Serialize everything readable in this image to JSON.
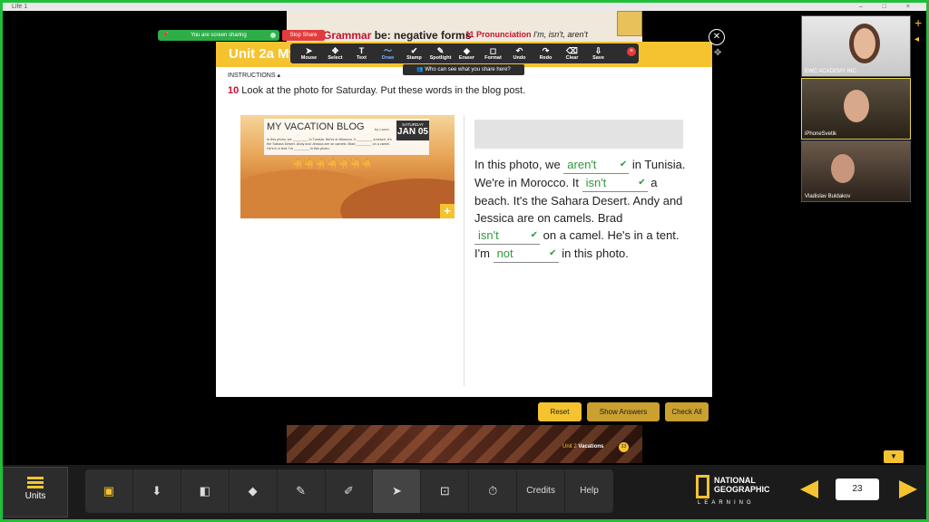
{
  "window": {
    "title": "Life 1",
    "controls": "– □ ×"
  },
  "share": {
    "status": "You are screen sharing",
    "stop_label": "Stop Share",
    "who_can_see": "Who can see what you share here?"
  },
  "lesson_strip": {
    "grammar_prefix": "Grammar ",
    "grammar_topic": "be: negative forms",
    "pron_num": "11",
    "pron_label": "Pronunciation",
    "pron_topic": "I'm, isn't, aren't"
  },
  "panel": {
    "unit_title": "Unit 2a My",
    "instructions_label": "INSTRUCTIONS ▴",
    "question_num": "10",
    "question_text": "Look at the photo for Saturday. Put these words in the blog post."
  },
  "toolbar": {
    "tools": [
      {
        "glyph": "➤",
        "label": "Mouse"
      },
      {
        "glyph": "✥",
        "label": "Select"
      },
      {
        "glyph": "T",
        "label": "Text"
      },
      {
        "glyph": "〜",
        "label": "Draw"
      },
      {
        "glyph": "✔",
        "label": "Stamp"
      },
      {
        "glyph": "✎",
        "label": "Spotlight"
      },
      {
        "glyph": "◆",
        "label": "Eraser"
      },
      {
        "glyph": "◻",
        "label": "Format"
      },
      {
        "glyph": "↶",
        "label": "Undo"
      },
      {
        "glyph": "↷",
        "label": "Redo"
      },
      {
        "glyph": "⌫",
        "label": "Clear"
      },
      {
        "glyph": "⇩",
        "label": "Save"
      }
    ],
    "close": "×"
  },
  "photo": {
    "blog_title": "MY VACATION BLOG",
    "blog_by": "by Laura",
    "date_day": "SATURDAY",
    "date": "JAN 05",
    "blog_lines": "In this photo, we ________ in Tunisia. We're in Morocco. It ________ a beach. It's the Sahara Desert. Andy and Jessica are on camels. Brad ________ on a camel. He's in a tent. I'm ________ in this photo.",
    "camels": "🐪🐪🐪🐪🐪🐪🐪",
    "expand": "+"
  },
  "blog_text": {
    "p1": "In this photo, we",
    "a1": "aren't",
    "p2": "in Tunisia. We're in Morocco. It",
    "a2": "isn't",
    "p3": "a beach. It's the Sahara Desert. Andy and Jessica are on camels. Brad",
    "a3": "isn't",
    "p4": "on a camel. He's in a tent. I'm",
    "a4": "not",
    "p5": "in this photo.",
    "check": "✔"
  },
  "buttons": {
    "reset": "Reset",
    "show_answers": "Show Answers",
    "check_all": "Check All"
  },
  "banner": {
    "unit": "Unit 2",
    "title": "Vacations",
    "page": "23"
  },
  "nav": {
    "units": "Units",
    "credits": "Credits",
    "help": "Help",
    "icons": [
      "▣",
      "⬇",
      "◧",
      "◆",
      "✎",
      "✐",
      "➤",
      "⊡",
      "⏱"
    ]
  },
  "brand": {
    "line1": "NATIONAL",
    "line2": "GEOGRAPHIC",
    "line3": "LEARNING"
  },
  "page_number": "23",
  "participants": [
    {
      "name": "EWC ACADEMY INC."
    },
    {
      "name": "iPhoneSvetik"
    },
    {
      "name": "Vladislav Buldakov"
    }
  ],
  "colors": {
    "accent": "#f5c330",
    "correct": "#2d9a3a",
    "share_green": "#1fbf3a",
    "stop_red": "#e23c3c"
  }
}
